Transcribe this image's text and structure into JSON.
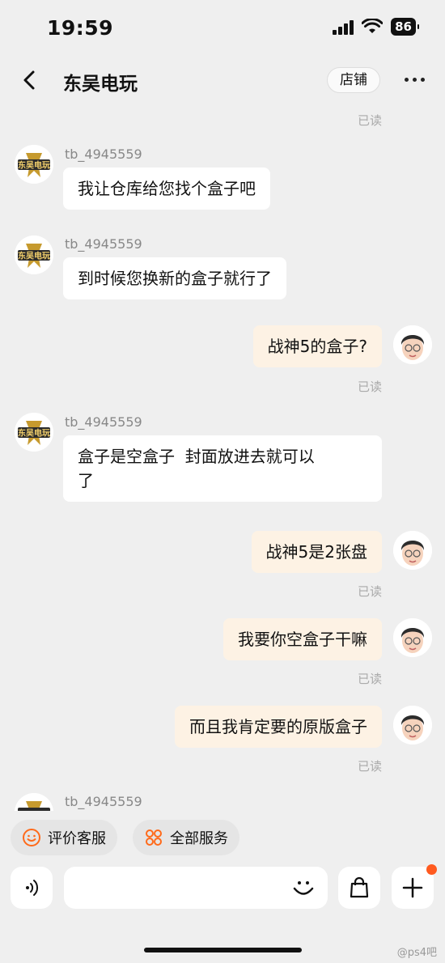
{
  "status_bar": {
    "time": "19:59",
    "battery": "86"
  },
  "nav": {
    "title": "东吴电玩",
    "store_button": "店铺"
  },
  "shop_avatar_text": "东吴电玩",
  "read_label": "已读",
  "messages": [
    {
      "username": "tb_4945559",
      "text": "我让仓库给您找个盒子吧"
    },
    {
      "username": "tb_4945559",
      "text": "到时候您换新的盒子就行了"
    },
    {
      "text": "战神5的盒子?"
    },
    {
      "username": "tb_4945559",
      "text": "盒子是空盒子  封面放进去就可以\n了"
    },
    {
      "text": "战神5是2张盘"
    },
    {
      "text": "我要你空盒子干嘛"
    },
    {
      "text": "而且我肯定要的原版盒子"
    },
    {
      "username": "tb_4945559"
    }
  ],
  "actions": {
    "rate_service": "评价客服",
    "all_services": "全部服务"
  },
  "watermark": "@ps4吧",
  "colors": {
    "outgoing_bubble": "#fdf2e4",
    "incoming_bubble": "#ffffff",
    "accent": "#ff5a1f",
    "background": "#efefef"
  }
}
